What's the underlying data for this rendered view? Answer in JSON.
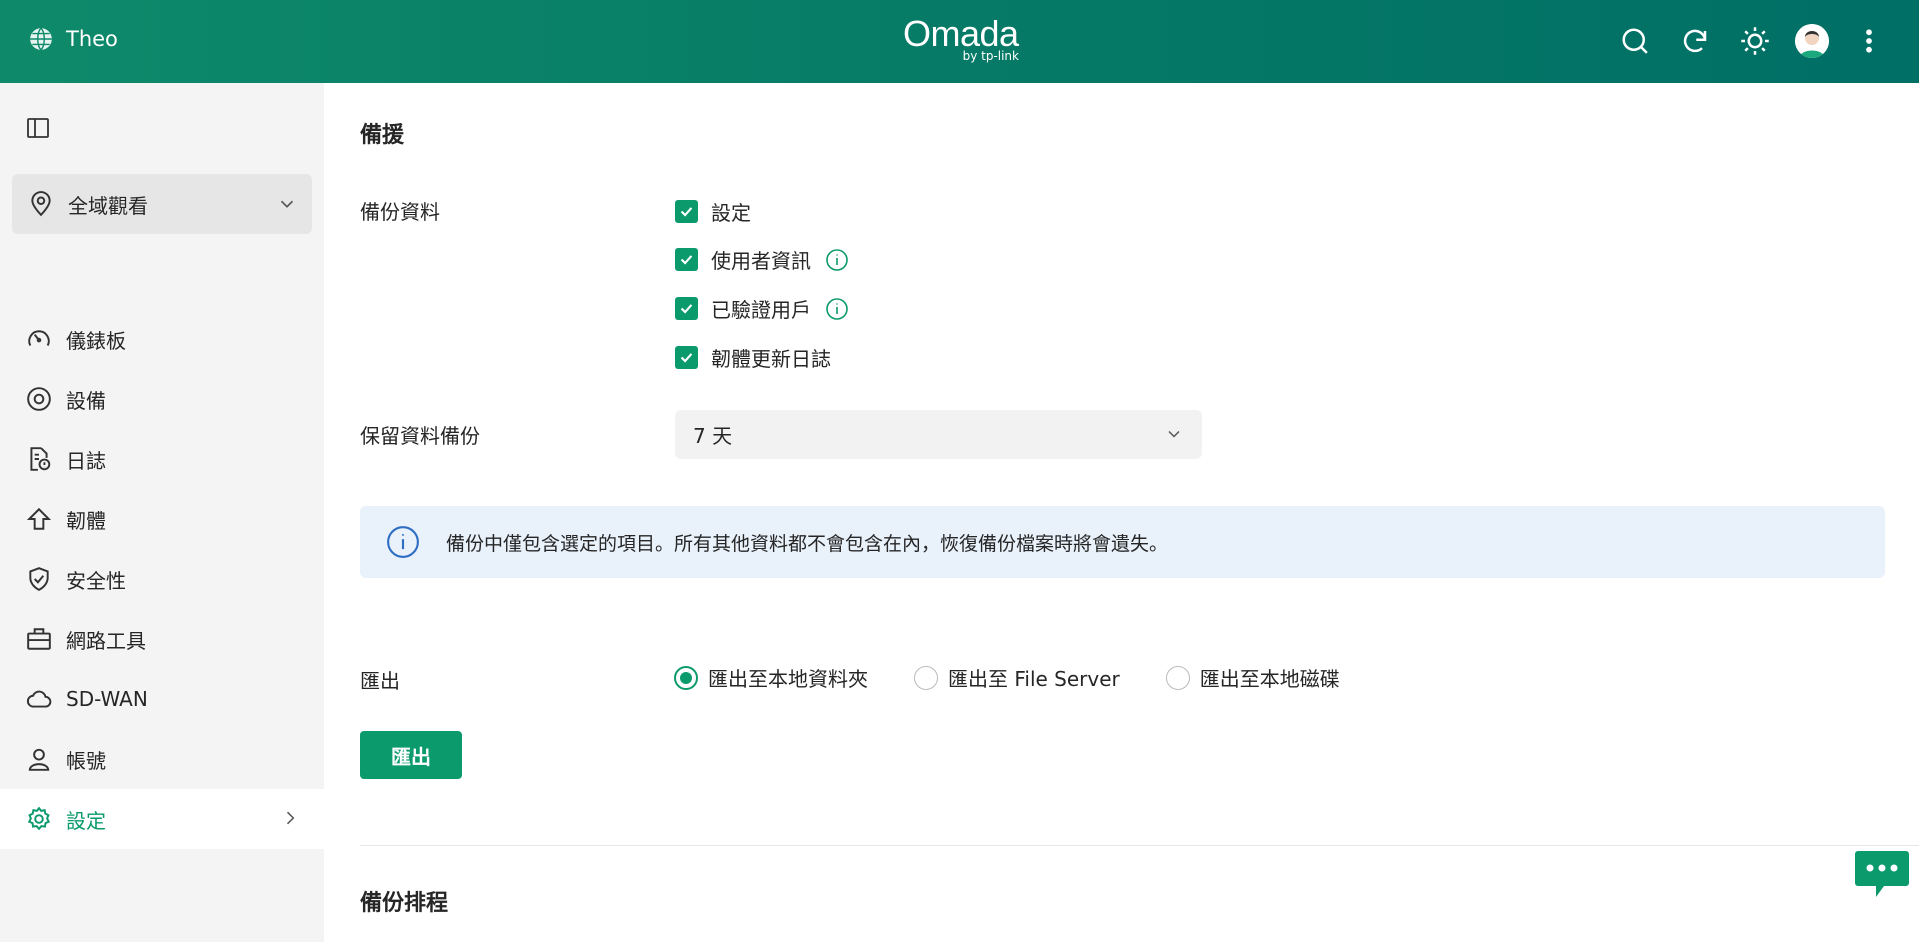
{
  "header": {
    "org_name": "Theo",
    "logo_main": "Omada",
    "logo_sub": "by tp-link",
    "icons": [
      "search-icon",
      "refresh-icon",
      "theme-sun-icon",
      "avatar",
      "more-vert-icon"
    ]
  },
  "sidebar": {
    "site_selector": "全域觀看",
    "items": [
      {
        "label": "儀錶板",
        "icon": "dashboard-icon"
      },
      {
        "label": "設備",
        "icon": "devices-icon"
      },
      {
        "label": "日誌",
        "icon": "logs-icon"
      },
      {
        "label": "韌體",
        "icon": "firmware-icon"
      },
      {
        "label": "安全性",
        "icon": "security-icon"
      },
      {
        "label": "網路工具",
        "icon": "network-tools-icon"
      },
      {
        "label": "SD-WAN",
        "icon": "cloud-icon"
      },
      {
        "label": "帳號",
        "icon": "account-icon"
      },
      {
        "label": "設定",
        "icon": "settings-icon",
        "active": true
      }
    ]
  },
  "main": {
    "backup_title": "備援",
    "backup_data_label": "備份資料",
    "checkboxes": [
      {
        "label": "設定",
        "checked": true
      },
      {
        "label": "使用者資訊",
        "checked": true,
        "info": true
      },
      {
        "label": "已驗證用戶",
        "checked": true,
        "info": true
      },
      {
        "label": "韌體更新日誌",
        "checked": true
      }
    ],
    "retain_label": "保留資料備份",
    "retain_value": "7 天",
    "notice": "備份中僅包含選定的項目。所有其他資料都不會包含在內，恢復備份檔案時將會遺失。",
    "export_label": "匯出",
    "export_options": [
      {
        "label": "匯出至本地資料夾",
        "checked": true
      },
      {
        "label": "匯出至 File Server",
        "checked": false
      },
      {
        "label": "匯出至本地磁碟",
        "checked": false
      }
    ],
    "export_button": "匯出",
    "schedule_title": "備份排程"
  },
  "colors": {
    "brand": "#0a9a6c",
    "header_start": "#0e8a6a",
    "header_end": "#006f66",
    "notice_bg": "#e9f1fb"
  }
}
